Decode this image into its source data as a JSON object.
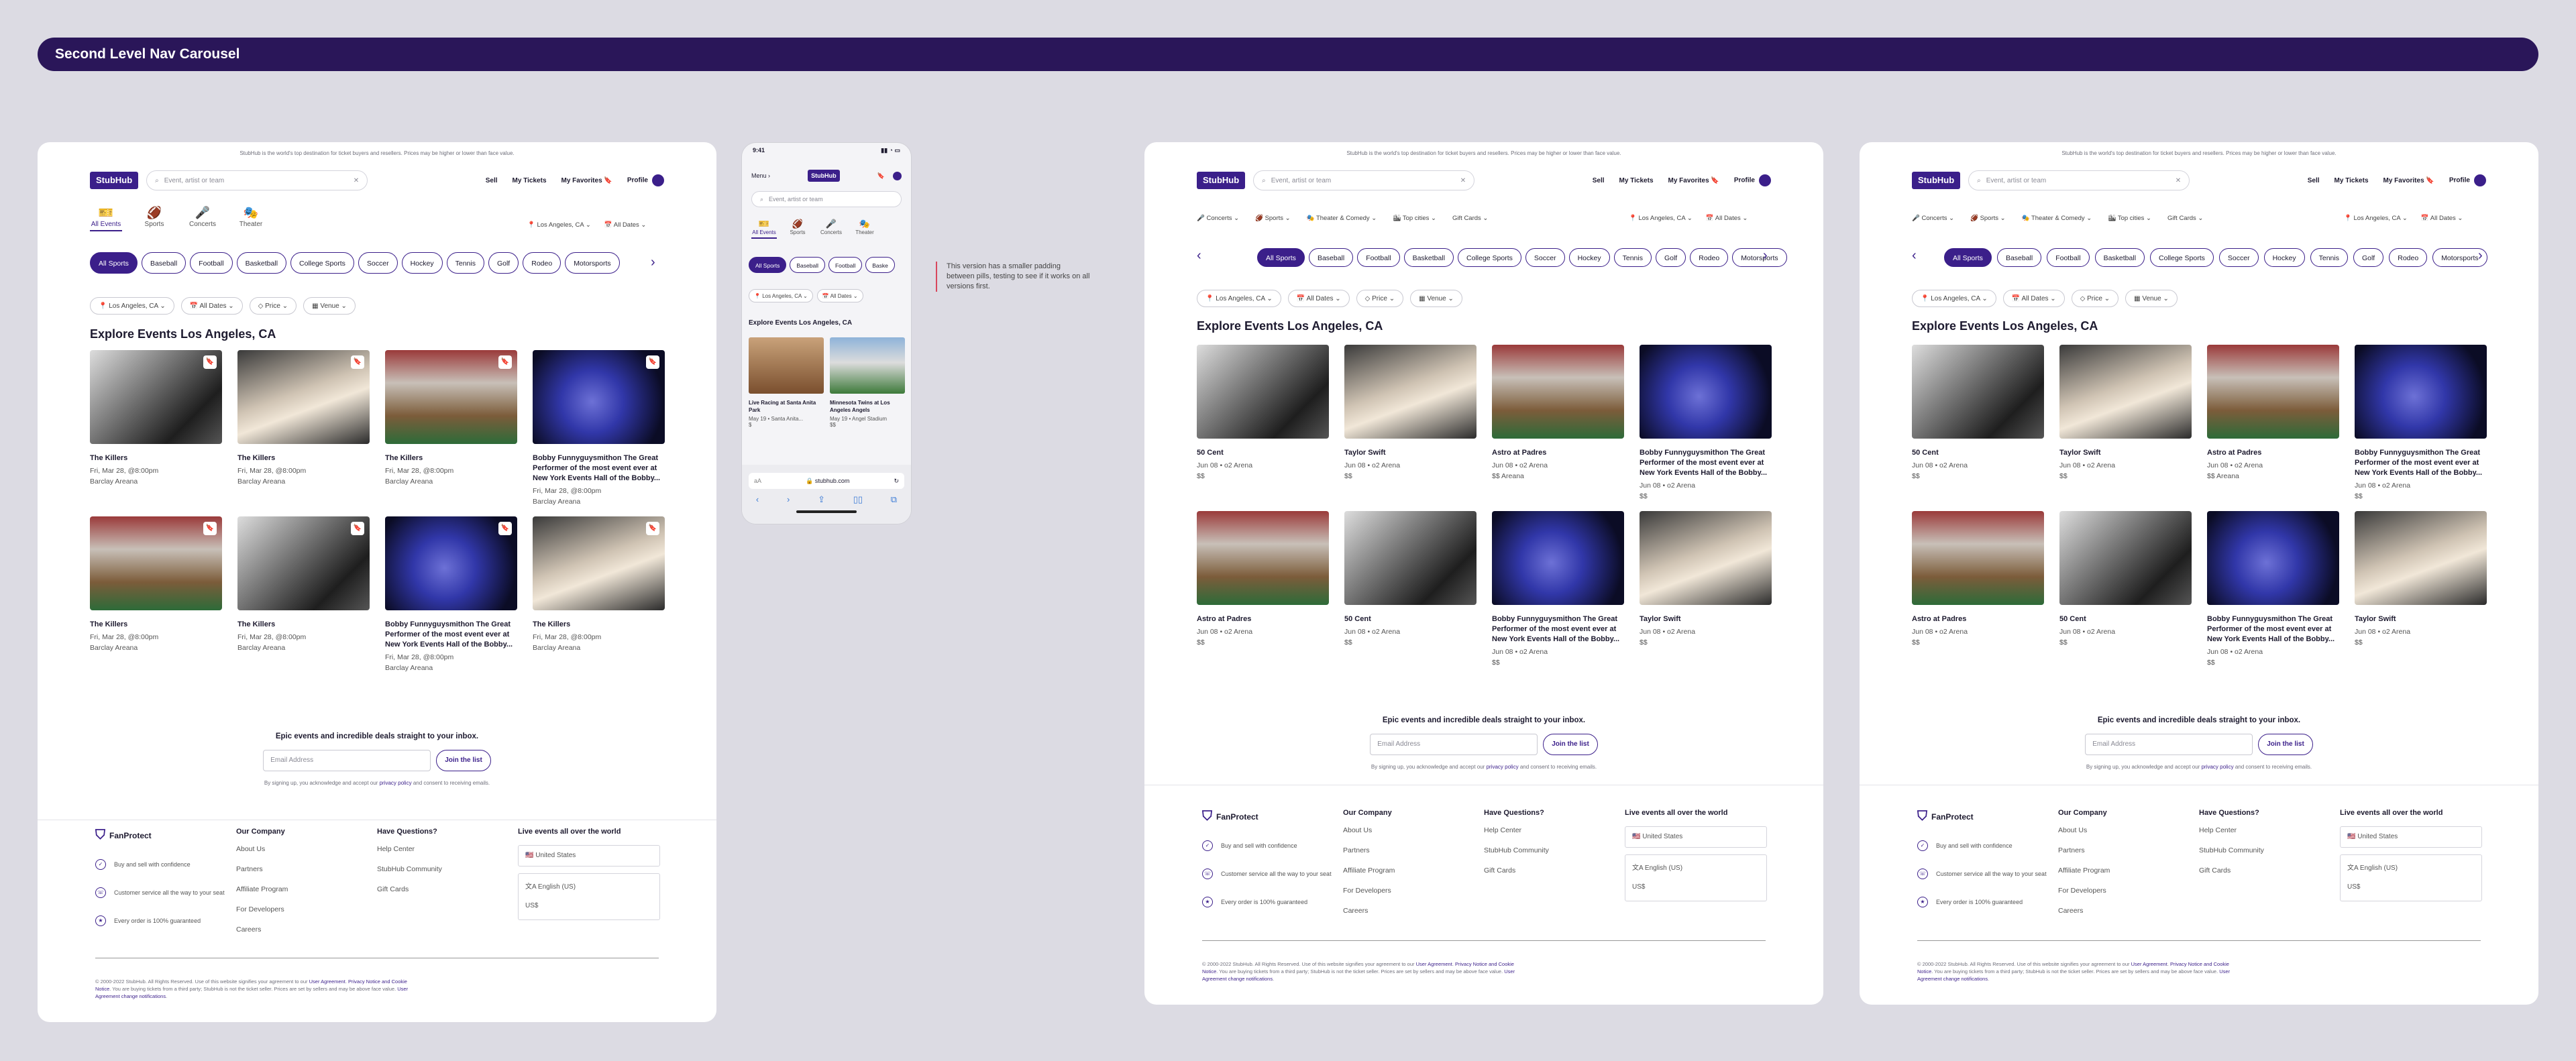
{
  "banner": {
    "title": "Second Level Nav Carousel"
  },
  "common": {
    "top_note": "StubHub is the world's top destination for ticket buyers and resellers. Prices may be higher or lower than face value.",
    "logo": "StubHub",
    "search_placeholder": "Event, artist or team",
    "nav_sell": "Sell",
    "nav_tickets": "My Tickets",
    "nav_favorites": "My Favorites",
    "nav_profile": "Profile",
    "location": "Los Angeles, CA",
    "dates": "All Dates",
    "price": "Price",
    "venue": "Venue",
    "page_title": "Explore Events Los Angeles, CA",
    "news_heading": "Epic events and incredible deals straight to your inbox.",
    "email_placeholder": "Email Address",
    "join": "Join the list",
    "news_fine_pre": "By signing up, you acknowledge and accept our",
    "news_fine_link": "privacy policy",
    "news_fine_post": "and consent to receiving emails.",
    "fanprotect": "FanProtect",
    "fp_items": [
      "Buy and sell with confidence",
      "Customer service all the way to your seat",
      "Every order is 100% guaranteed"
    ],
    "company_head": "Our Company",
    "company_links": [
      "About Us",
      "Partners",
      "Affiliate Program",
      "For Developers",
      "Careers"
    ],
    "questions_head": "Have Questions?",
    "questions_links": [
      "Help Center",
      "StubHub Community",
      "Gift Cards"
    ],
    "world_head": "Live events all over the world",
    "country": "United States",
    "language": "English (US)",
    "currency": "US$",
    "legal_1": "© 2000-2022 StubHub. All Rights Reserved. Use of this website signifies your agreement to our",
    "legal_link_1": "User Agreement",
    "legal_link_2": "Privacy Notice and Cookie Notice",
    "legal_2": ". You are buying tickets from a third party; StubHub is not the ticket seller. Prices are set by sellers and may be above face value.",
    "legal_link_3": "User Agreement change notifications"
  },
  "v1": {
    "categories": [
      "All Events",
      "Sports",
      "Concerts",
      "Theater"
    ],
    "pills": [
      "All Sports",
      "Baseball",
      "Football",
      "Basketball",
      "College Sports",
      "Soccer",
      "Hockey",
      "Tennis",
      "Golf",
      "Rodeo",
      "Motorsports"
    ],
    "cards": [
      {
        "title": "The Killers",
        "date": "Fri, Mar 28, @8:00pm",
        "venue": "Barclay Areana"
      },
      {
        "title": "The Killers",
        "date": "Fri, Mar 28, @8:00pm",
        "venue": "Barclay Areana"
      },
      {
        "title": "The Killers",
        "date": "Fri, Mar 28, @8:00pm",
        "venue": "Barclay Areana"
      },
      {
        "title": "Bobby Funnyguysmithon The Great Performer of the most event ever at New York Events Hall of the Bobby...",
        "date": "Fri, Mar 28, @8:00pm",
        "venue": "Barclay Areana"
      },
      {
        "title": "The Killers",
        "date": "Fri, Mar 28, @8:00pm",
        "venue": "Barclay Areana"
      },
      {
        "title": "The Killers",
        "date": "Fri, Mar 28, @8:00pm",
        "venue": "Barclay Areana"
      },
      {
        "title": "Bobby Funnyguysmithon The Great Performer of the most event ever at New York Events Hall of the Bobby...",
        "date": "Fri, Mar 28, @8:00pm",
        "venue": "Barclay Areana"
      },
      {
        "title": "The Killers",
        "date": "Fri, Mar 28, @8:00pm",
        "venue": "Barclay Areana"
      }
    ]
  },
  "v2": {
    "menus": [
      "Concerts",
      "Sports",
      "Theater & Comedy",
      "Top cities",
      "Gift Cards"
    ],
    "pills": [
      "All Sports",
      "Baseball",
      "Football",
      "Basketball",
      "College Sports",
      "Soccer",
      "Hockey",
      "Tennis",
      "Golf",
      "Rodeo",
      "Motorsports"
    ],
    "cards": [
      {
        "title": "50 Cent",
        "date": "Jun 08 • o2 Arena",
        "venue": "$$"
      },
      {
        "title": "Taylor Swift",
        "date": "Jun 08 • o2 Arena",
        "venue": "$$"
      },
      {
        "title": "Astro at Padres",
        "date": "Jun 08 • o2 Arena",
        "venue": "$$ Areana"
      },
      {
        "title": "Bobby Funnyguysmithon The Great Performer of the most event ever at New York Events Hall of the Bobby...",
        "date": "Jun 08 • o2 Arena",
        "venue": "$$"
      },
      {
        "title": "Astro at Padres",
        "date": "Jun 08 • o2 Arena",
        "venue": "$$"
      },
      {
        "title": "50 Cent",
        "date": "Jun 08 • o2 Arena",
        "venue": "$$"
      },
      {
        "title": "Bobby Funnyguysmithon The Great Performer of the most event ever at New York Events Hall of the Bobby...",
        "date": "Jun 08 • o2 Arena",
        "venue": "$$"
      },
      {
        "title": "Taylor Swift",
        "date": "Jun 08 • o2 Arena",
        "venue": "$$"
      }
    ]
  },
  "mobile": {
    "time": "9:41",
    "menu": "Menu",
    "logo": "StubHub",
    "search_placeholder": "Event, artist or team",
    "categories": [
      "All Events",
      "Sports",
      "Concerts",
      "Theater"
    ],
    "pills": [
      "All Sports",
      "Baseball",
      "Football",
      "Baske"
    ],
    "location": "Los Angeles, CA",
    "dates": "All Dates",
    "title": "Explore Events Los Angeles, CA",
    "cards": [
      {
        "title": "Live Racing at Santa Anita Park",
        "date": "May 19 • Santa Anita...",
        "price": "$"
      },
      {
        "title": "Minnesota Twins at Los Angeles Angels",
        "date": "May 19 • Angel Stadium",
        "price": "$$"
      }
    ],
    "url": "stubhub.com",
    "aa": "aA"
  },
  "note": "This version has a smaller padding between pills, testing to see if it works on all versions first."
}
